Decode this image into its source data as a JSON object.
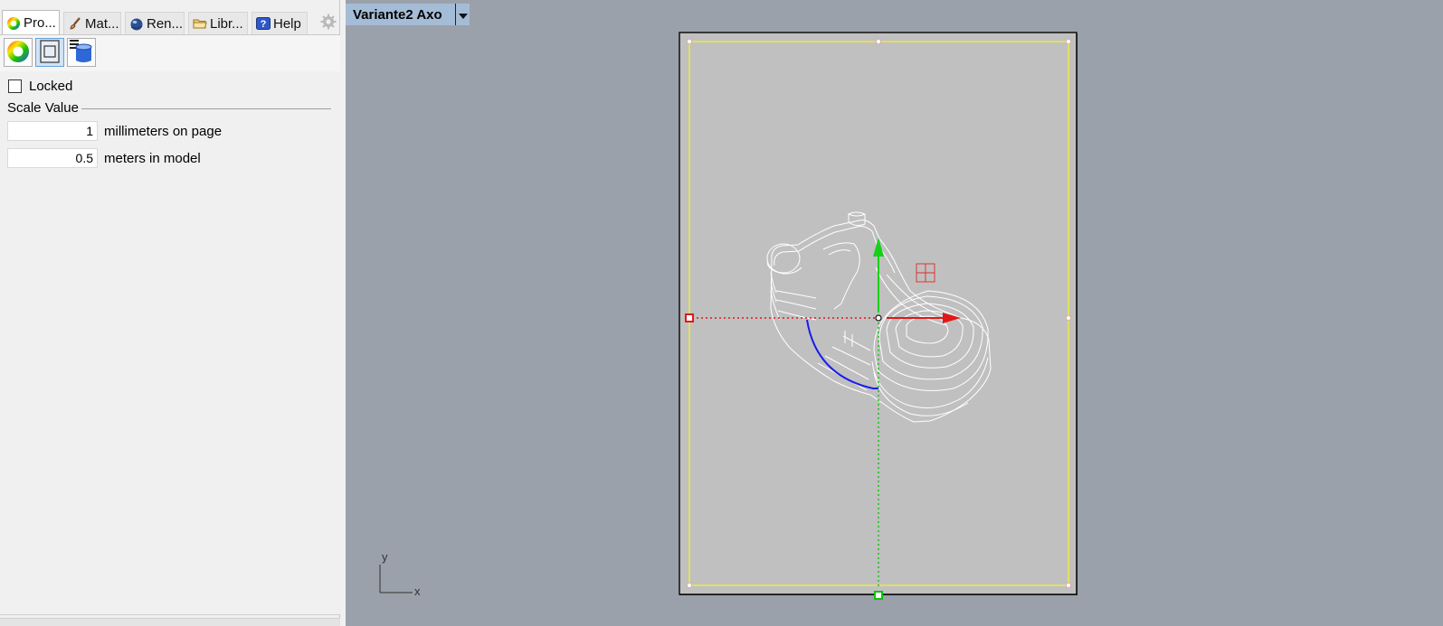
{
  "panel": {
    "tabs": [
      {
        "label": "Pro...",
        "icon": "color-wheel-icon"
      },
      {
        "label": "Mat...",
        "icon": "paintbrush-icon"
      },
      {
        "label": "Ren...",
        "icon": "globe-teapot-icon"
      },
      {
        "label": "Libr...",
        "icon": "folder-icon"
      },
      {
        "label": "Help",
        "icon": "help-icon"
      }
    ],
    "settings_icon": "gear-icon",
    "toolbar_icons": [
      "color-wheel-icon",
      "detail-view-icon",
      "layers-stack-icon"
    ],
    "locked_label": "Locked",
    "locked_checked": false,
    "scale_group_label": "Scale Value",
    "page_value": "1",
    "page_unit_label": "millimeters on page",
    "model_value": "0.5",
    "model_unit_label": "meters in model"
  },
  "viewport": {
    "title": "Variante2 Axo",
    "axis_y_label": "y",
    "axis_x_label": "x",
    "background_color": "#9aa1aa",
    "page_color": "#c0c0c0",
    "detail_border_color": "#ffff00"
  }
}
